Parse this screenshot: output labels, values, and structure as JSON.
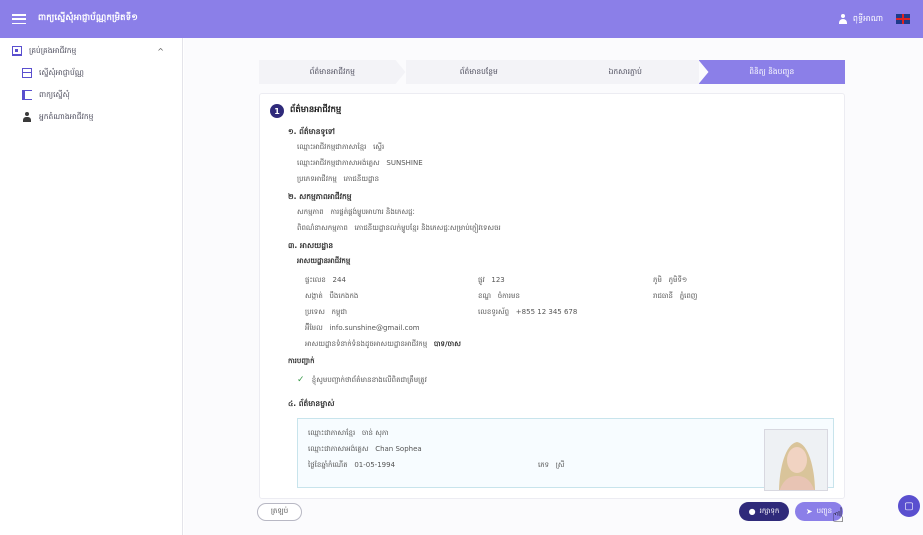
{
  "header": {
    "title": "ពាក្យស្នើសុំអាជ្ញាប័ណ្ណកម្រិតទី១",
    "user_name": "ពុទ្ធីអាណា"
  },
  "sidebar": {
    "group_label": "គ្រប់គ្រងអាជីវកម្ម",
    "items": [
      {
        "label": "ស្នើសុំអាជ្ញាប័ណ្ណ"
      },
      {
        "label": "ពាក្យស្នើសុំ"
      },
      {
        "label": "អ្នកតំណាងអាជីវកម្ម"
      }
    ]
  },
  "stepper": {
    "steps": [
      {
        "label": "ព័ត៌មានអាជីវកម្ម"
      },
      {
        "label": "ព័ត៌មានបន្ថែម"
      },
      {
        "label": "ឯកសារភ្ជាប់"
      },
      {
        "label": "ពិនិត្យ និងបញ្ជូន"
      }
    ]
  },
  "content": {
    "section_number": "1",
    "section_title": "ព័ត៌មានអាជីវកម្ម",
    "sub1": "១. ព័ត៌មានទូទៅ",
    "row_name_kh_label": "ឈ្មោះអាជីវកម្មជាភាសាខ្មែរ",
    "row_name_kh_value": "ស្ទើរ",
    "row_name_en_label": "ឈ្មោះអាជីវកម្មជាភាសាអង់គ្លេស",
    "row_name_en_value": "SUNSHINE",
    "row_type_label": "ប្រភេទអាជីវកម្ម",
    "row_type_value": "ភោជនីយដ្ឋាន",
    "sub2": "២. សកម្មភាពអាជីវកម្ម",
    "row_activity_label": "សកម្មភាព",
    "row_activity_value": "ការផ្គត់ផ្គង់ម្ហូបអាហារ និងភេសជ្ជៈ",
    "row_desc_label": "ពិពណ៌នាសកម្មភាព",
    "row_desc_value": "ភោជនីយដ្ឋានលក់ម្ហូបខ្មែរ និងភេសជ្ជៈសម្រាប់ភ្ញៀវទេសចរ",
    "sub3": "៣. អាសយដ្ឋាន",
    "addr_title": "អាសយដ្ឋានអាជីវកម្ម",
    "house_label": "ផ្ទះលេខ",
    "house_value": "244",
    "street_label": "ផ្លូវ",
    "street_value": "123",
    "village_label": "ភូមិ",
    "village_value": "ភូមិទី១",
    "commune_label": "សង្កាត់",
    "commune_value": "បឹងកេងកង",
    "district_label": "ខណ្ឌ",
    "district_value": "ចំការមន",
    "province_label": "រាជធានី",
    "province_value": "ភ្នំពេញ",
    "country_label": "ប្រទេស",
    "country_value": "កម្ពុជា",
    "phone_label": "លេខទូរស័ព្ទ",
    "phone_value": "+855 12 345 678",
    "email_label": "អ៊ីមែល",
    "email_value": "info.sunshine@gmail.com",
    "same_addr_label": "អាសយដ្ឋានទំនាក់ទំនងដូចអាសយដ្ឋានអាជីវកម្ម",
    "same_addr_value": "បាទ/ចាស",
    "confirm_title": "ការបញ្ជាក់",
    "confirm_text": "ខ្ញុំសូមបញ្ជាក់ថាព័ត៌មានខាងលើពិតជាត្រឹមត្រូវ",
    "sub4": "៤. ព័ត៌មានម្ចាស់",
    "owner_kh_label": "ឈ្មោះជាភាសាខ្មែរ",
    "owner_kh_value": "ចាន់ សុភា",
    "owner_en_label": "ឈ្មោះជាភាសាអង់គ្លេស",
    "owner_en_value": "Chan Sophea",
    "dob_label": "ថ្ងៃខែឆ្នាំកំណើត",
    "dob_value": "01-05-1994",
    "gender_label": "ភេទ",
    "gender_value": "ស្រី"
  },
  "actions": {
    "back_label": "ត្រឡប់",
    "save_label": "រក្សាទុក",
    "next_label": "បញ្ជូន"
  }
}
